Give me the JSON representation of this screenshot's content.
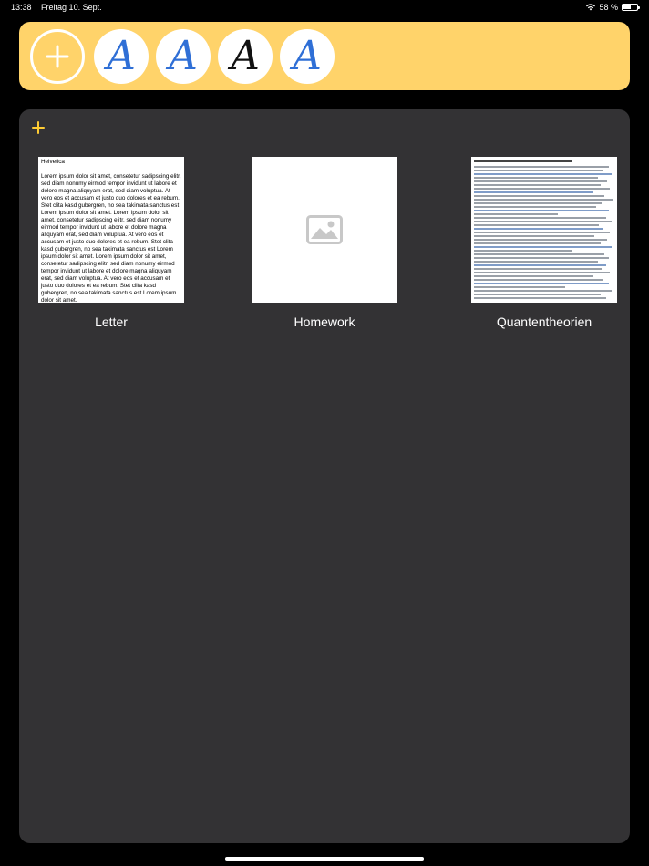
{
  "status_bar": {
    "time": "13:38",
    "date": "Freitag 10. Sept.",
    "battery_percent": "58 %",
    "battery_level": 0.58
  },
  "toolbar": {
    "background_color": "#ffd36a",
    "add_button_icon": "plus-icon",
    "fonts": [
      {
        "glyph": "A",
        "color": "#2f6fd6"
      },
      {
        "glyph": "A",
        "color": "#2f6fd6"
      },
      {
        "glyph": "A",
        "color": "#111111"
      },
      {
        "glyph": "A",
        "color": "#2f6fd6"
      }
    ]
  },
  "panel": {
    "add_icon": "plus-icon",
    "accent_color": "#ffcc33",
    "documents": [
      {
        "label": "Letter",
        "thumb_title": "Helvetica",
        "thumb_body": "Lorem ipsum dolor sit amet, consetetur sadipscing elitr, sed diam nonumy eirmod tempor invidunt ut labore et dolore magna aliquyam erat, sed diam voluptua. At vero eos et accusam et justo duo dolores et ea rebum. Stet clita kasd gubergren, no sea takimata sanctus est Lorem ipsum dolor sit amet. Lorem ipsum dolor sit amet, consetetur sadipscing elitr, sed diam nonumy eirmod tempor invidunt ut labore et dolore magna aliquyam erat, sed diam voluptua. At vero eos et accusam et justo duo dolores et ea rebum. Stet clita kasd gubergren, no sea takimata sanctus est Lorem ipsum dolor sit amet. Lorem ipsum dolor sit amet, consetetur sadipscing elitr, sed diam nonumy eirmod tempor invidunt ut labore et dolore magna aliquyam erat, sed diam voluptua. At vero eos et accusam et justo duo dolores et ea rebum. Stet clita kasd gubergren, no sea takimata sanctus est Lorem ipsum dolor sit amet."
      },
      {
        "label": "Homework",
        "thumb_icon": "image-placeholder-icon"
      },
      {
        "label": "Quantentheorien",
        "thumb_icon": "text-page-preview"
      }
    ]
  }
}
